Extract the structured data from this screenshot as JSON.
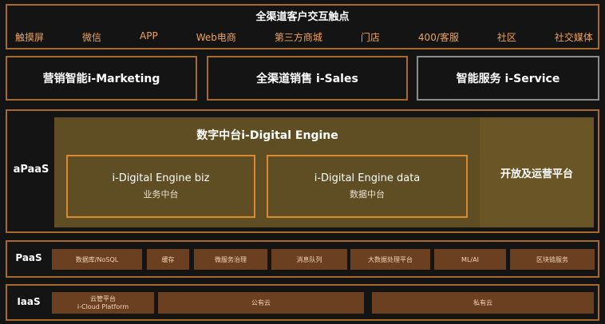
{
  "touchpoints": {
    "title": "全渠道客户交互触点",
    "items": [
      "触摸屏",
      "微信",
      "APP",
      "Web电商",
      "第三方商城",
      "门店",
      "400/客服",
      "社区",
      "社交媒体"
    ]
  },
  "services": {
    "marketing": "营销智能i-Marketing",
    "sales": "全渠道销售 i-Sales",
    "service": "智能服务 i-Service"
  },
  "apaas": {
    "label": "aPaaS",
    "engine_title": "数字中台i-Digital Engine",
    "biz_main": "i-Digital Engine  biz",
    "biz_sub": "业务中台",
    "data_main": "i-Digital Engine  data",
    "data_sub": "数据中台",
    "open_platform": "开放及运营平台"
  },
  "paas": {
    "label": "PaaS",
    "items": [
      "数据库/NoSQL",
      "缓存",
      "微服务治理",
      "消息队列",
      "大数据处理平台",
      "ML/AI",
      "区块链服务"
    ]
  },
  "iaas": {
    "label": "IaaS",
    "cloud_platform_cn": "云管平台",
    "cloud_platform_en": "i-Cloud Platform",
    "public_cloud": "公有云",
    "private_cloud": "私有云"
  },
  "colors": {
    "background": "#141414",
    "frame": "#a9692b",
    "accent_text": "#f0a25a",
    "engine_fill": "#5f4e23",
    "chip_fill": "#6b4021"
  }
}
